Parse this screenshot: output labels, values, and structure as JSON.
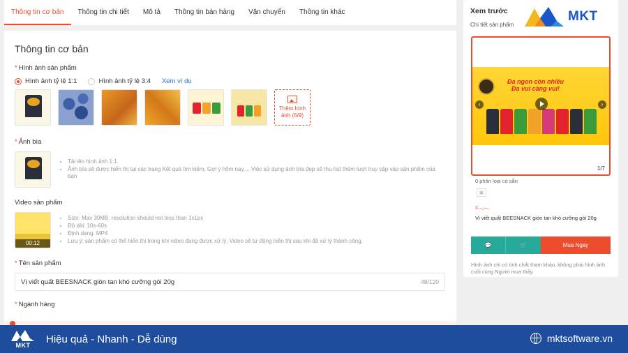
{
  "tabs": [
    {
      "label": "Thông tin cơ bản",
      "active": true
    },
    {
      "label": "Thông tin chi tiết"
    },
    {
      "label": "Mô tả"
    },
    {
      "label": "Thông tin bán hàng"
    },
    {
      "label": "Vận chuyển"
    },
    {
      "label": "Thông tin khác"
    }
  ],
  "card": {
    "title": "Thông tin cơ bản",
    "images": {
      "label": "Hình ảnh sản phẩm",
      "ratio_1_1": "Hình ảnh tỷ lệ 1:1",
      "ratio_3_4": "Hình ảnh tỷ lệ 3:4",
      "example_link": "Xem ví dụ",
      "add_label_1": "Thêm hình",
      "add_label_2": "ảnh (6/9)"
    },
    "cover": {
      "label": "Ảnh bìa",
      "hint1": "Tải lên hình ảnh 1:1.",
      "hint2": "Ảnh bìa sẽ được hiển thị tại các trang Kết quả tìm kiếm, Gợi ý hôm nay,... Việc sử dụng ảnh bìa đẹp sẽ thu hút thêm lượt truy cập vào sản phẩm của bạn"
    },
    "video": {
      "label": "Video sản phẩm",
      "duration": "00:12",
      "hint1": "Size: Max 30MB, resolution should not less than 1x1px",
      "hint2": "Độ dài: 10s-60s",
      "hint3": "Định dạng: MP4",
      "hint4": "Lưu ý: sản phẩm có thể hiển thị trong khi video đang được xử lý. Video sẽ tự động hiển thị sau khi đã xử lý thành công."
    },
    "name": {
      "label": "Tên sản phẩm",
      "value": "Vị viết quất BEESNACK giòn tan khó cưỡng gói 20g",
      "count": "48/120"
    },
    "category": {
      "label": "Ngành hàng"
    }
  },
  "preview": {
    "title": "Xem trước",
    "subtitle": "Chi tiết sản phẩm",
    "banner_line1": "Đa ngon còn nhiều",
    "banner_line2": "Đa vui càng vui!",
    "image_count": "1/7",
    "variant_text": "0 phân loại có sẵn",
    "price": "₫--.---",
    "product_name": "Vị viết quất BEESNACK giòn tan khó cưỡng gói 20g",
    "buy_label": "Mua Ngay",
    "note": "Hình ảnh chỉ có tính chất tham khảo, không phải hình ảnh cuối cùng Người mua thấy."
  },
  "brand": {
    "name": "MKT"
  },
  "footer": {
    "logo_text": "MKT",
    "slogan": "Hiệu quả - Nhanh - Dễ dùng",
    "website": "mktsoftware.vn"
  },
  "colors": {
    "accent": "#ee4d2d",
    "teal": "#26aa99",
    "footer_bg": "#1e4d9e",
    "brand_blue": "#1a56c7"
  }
}
